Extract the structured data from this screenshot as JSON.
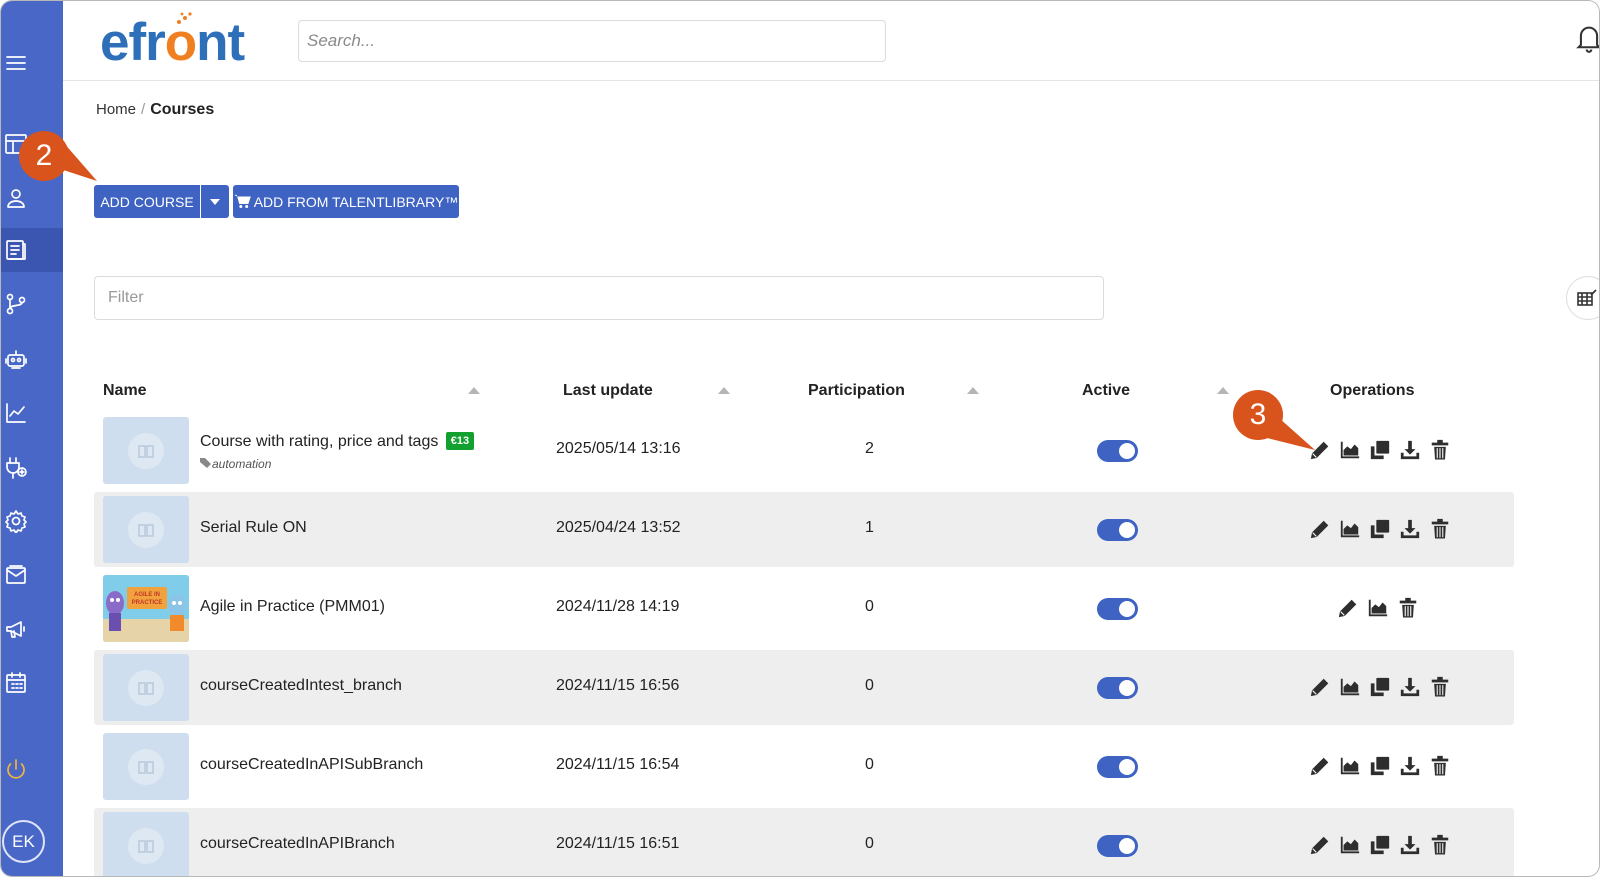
{
  "app": {
    "logo_text_1": "efr",
    "logo_text_o": "o",
    "logo_text_2": "nt"
  },
  "search": {
    "placeholder": "Search..."
  },
  "sidebar": {
    "items": [
      {
        "icon": "menu-icon"
      },
      {
        "icon": "dashboard-icon"
      },
      {
        "icon": "user-icon"
      },
      {
        "icon": "courses-icon",
        "active": true
      },
      {
        "icon": "branches-icon"
      },
      {
        "icon": "automation-robot-icon"
      },
      {
        "icon": "reports-chart-icon"
      },
      {
        "icon": "plugins-icon"
      },
      {
        "icon": "settings-gear-icon"
      },
      {
        "icon": "messages-icon"
      },
      {
        "icon": "announcements-icon"
      },
      {
        "icon": "calendar-icon"
      },
      {
        "icon": "power-icon"
      }
    ],
    "avatar_initials": "EK"
  },
  "breadcrumb": {
    "home": "Home",
    "separator": "/",
    "current": "Courses"
  },
  "toolbar": {
    "add_course_label": "ADD COURSE",
    "add_from_library_label": "ADD FROM TALENTLIBRARY™"
  },
  "callouts": {
    "first": "2",
    "second": "3"
  },
  "filter": {
    "placeholder": "Filter"
  },
  "table": {
    "headers": {
      "name": "Name",
      "last_update": "Last update",
      "participation": "Participation",
      "active": "Active",
      "operations": "Operations"
    },
    "rows": [
      {
        "name": "Course with rating, price and tags",
        "price": "€13",
        "tag": "automation",
        "last_update": "2025/05/14 13:16",
        "participation": "2",
        "active": true,
        "operations": [
          "edit",
          "reports",
          "copy",
          "export",
          "delete"
        ]
      },
      {
        "name": "Serial Rule ON",
        "last_update": "2025/04/24 13:52",
        "participation": "1",
        "active": true,
        "operations": [
          "edit",
          "reports",
          "copy",
          "export",
          "delete"
        ]
      },
      {
        "name": "Agile in Practice (PMM01)",
        "thumbnail_text": "AGILE IN PRACTICE",
        "last_update": "2024/11/28 14:19",
        "participation": "0",
        "active": true,
        "operations": [
          "edit",
          "reports",
          "delete"
        ]
      },
      {
        "name": "courseCreatedIntest_branch",
        "last_update": "2024/11/15 16:56",
        "participation": "0",
        "active": true,
        "operations": [
          "edit",
          "reports",
          "copy",
          "export",
          "delete"
        ]
      },
      {
        "name": "courseCreatedInAPISubBranch",
        "last_update": "2024/11/15 16:54",
        "participation": "0",
        "active": true,
        "operations": [
          "edit",
          "reports",
          "copy",
          "export",
          "delete"
        ]
      },
      {
        "name": "courseCreatedInAPIBranch",
        "last_update": "2024/11/15 16:51",
        "participation": "0",
        "active": true,
        "operations": [
          "edit",
          "reports",
          "copy",
          "export",
          "delete"
        ]
      }
    ]
  },
  "colors": {
    "sidebar": "#4867c7",
    "primary": "#3e63c3",
    "logo_blue": "#2d6fb8",
    "logo_orange": "#f07f22",
    "callout": "#d9541c",
    "price_badge": "#12a12f"
  }
}
